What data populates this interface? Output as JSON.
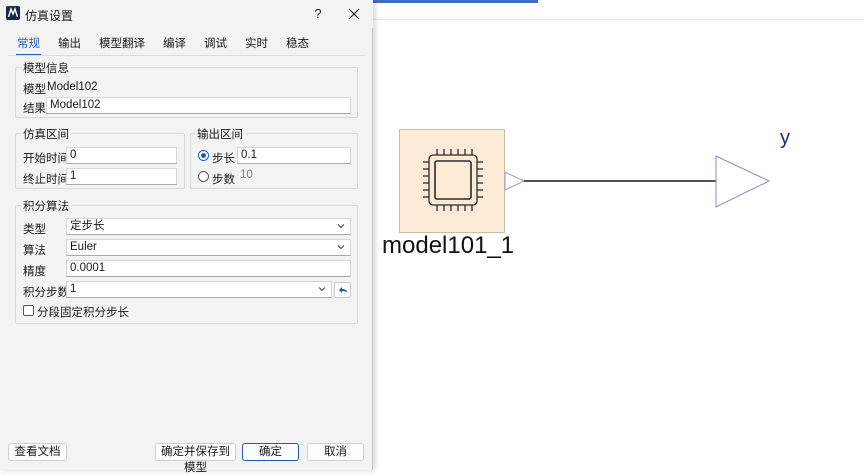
{
  "canvas": {
    "block_name": "model101_1",
    "output_name": "y"
  },
  "dialog": {
    "title": "仿真设置",
    "help_label": "?",
    "tabs": [
      {
        "label": "常规",
        "active": true
      },
      {
        "label": "输出"
      },
      {
        "label": "模型翻译"
      },
      {
        "label": "编译"
      },
      {
        "label": "调试"
      },
      {
        "label": "实时"
      },
      {
        "label": "稳态"
      }
    ],
    "model_info": {
      "title": "模型信息",
      "model_label": "模型",
      "model_value": "Model102",
      "result_label": "结果",
      "result_value": "Model102"
    },
    "sim_interval": {
      "title": "仿真区间",
      "start_label": "开始时间",
      "start_value": "0",
      "stop_label": "终止时间",
      "stop_value": "1"
    },
    "output_interval": {
      "title": "输出区间",
      "step_label": "步长",
      "step_value": "0.1",
      "count_label": "步数",
      "count_value": "10",
      "selected": "step"
    },
    "integration": {
      "title": "积分算法",
      "type_label": "类型",
      "type_value": "定步长",
      "algo_label": "算法",
      "algo_value": "Euler",
      "precision_label": "精度",
      "precision_value": "0.0001",
      "steps_label": "积分步数",
      "steps_value": "1",
      "fixed_checkbox_label": "分段固定积分步长",
      "fixed_checked": false
    },
    "buttons": {
      "docs": "查看文档",
      "save_to_model": "确定并保存到模型",
      "ok": "确定",
      "cancel": "取消"
    }
  },
  "colors": {
    "accent": "#1f5bb5",
    "block_fill": "#fcebd6",
    "port_stroke": "#8a8ad0"
  }
}
